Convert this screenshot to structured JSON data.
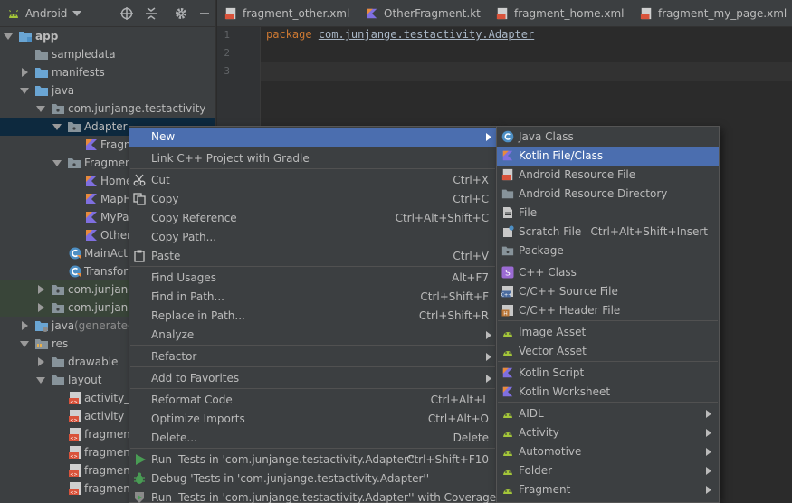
{
  "project_panel": {
    "view_label": "Android",
    "tree": [
      {
        "label": "app",
        "bold": true
      },
      {
        "label": "sampledata"
      },
      {
        "label": "manifests"
      },
      {
        "label": "java"
      },
      {
        "label": "com.junjange.testactivity"
      },
      {
        "label": "Adapter"
      },
      {
        "label": "Fragm"
      },
      {
        "label": "Fragment"
      },
      {
        "label": "Home"
      },
      {
        "label": "MapF"
      },
      {
        "label": "MyPa"
      },
      {
        "label": "Other"
      },
      {
        "label": "MainActi"
      },
      {
        "label": "Transform"
      },
      {
        "label": "com.junjang"
      },
      {
        "label": "com.junjang"
      },
      {
        "label": "java",
        "suffix": "(generated)"
      },
      {
        "label": "res"
      },
      {
        "label": "drawable"
      },
      {
        "label": "layout"
      },
      {
        "label": "activity_n"
      },
      {
        "label": "activity_tr"
      },
      {
        "label": "fragment"
      },
      {
        "label": "fragment"
      },
      {
        "label": "fragment"
      },
      {
        "label": "fragment"
      }
    ]
  },
  "editor": {
    "tabs": [
      {
        "label": "fragment_other.xml",
        "icon": "xml-file-icon"
      },
      {
        "label": "OtherFragment.kt",
        "icon": "kotlin-file-icon"
      },
      {
        "label": "fragment_home.xml",
        "icon": "xml-file-icon"
      },
      {
        "label": "fragment_my_page.xml",
        "icon": "xml-file-icon"
      }
    ],
    "line_numbers": [
      "1",
      "2",
      "3"
    ],
    "keyword": "package",
    "package_name": "com.junjange.testactivity.Adapter"
  },
  "context_menu": [
    {
      "label": "New",
      "submenu": true
    },
    {
      "label": "Link C++ Project with Gradle"
    },
    {
      "label": "Cut",
      "shortcut": "Ctrl+X",
      "icon": "cut"
    },
    {
      "label": "Copy",
      "shortcut": "Ctrl+C",
      "icon": "copy"
    },
    {
      "label": "Copy Reference",
      "shortcut": "Ctrl+Alt+Shift+C"
    },
    {
      "label": "Copy Path..."
    },
    {
      "label": "Paste",
      "shortcut": "Ctrl+V",
      "icon": "paste"
    },
    {
      "label": "Find Usages",
      "shortcut": "Alt+F7"
    },
    {
      "label": "Find in Path...",
      "shortcut": "Ctrl+Shift+F"
    },
    {
      "label": "Replace in Path...",
      "shortcut": "Ctrl+Shift+R"
    },
    {
      "label": "Analyze",
      "submenu": true
    },
    {
      "label": "Refactor",
      "submenu": true
    },
    {
      "label": "Add to Favorites",
      "submenu": true
    },
    {
      "label": "Reformat Code",
      "shortcut": "Ctrl+Alt+L"
    },
    {
      "label": "Optimize Imports",
      "shortcut": "Ctrl+Alt+O"
    },
    {
      "label": "Delete...",
      "shortcut": "Delete"
    },
    {
      "label": "Run 'Tests in 'com.junjange.testactivity.Adapter''",
      "shortcut": "Ctrl+Shift+F10",
      "icon": "run"
    },
    {
      "label": "Debug 'Tests in 'com.junjange.testactivity.Adapter''",
      "icon": "debug"
    },
    {
      "label": "Run 'Tests in 'com.junjange.testactivity.Adapter'' with Coverage",
      "icon": "coverage"
    }
  ],
  "submenu": [
    {
      "label": "Java Class",
      "icon": "java-class"
    },
    {
      "label": "Kotlin File/Class",
      "icon": "kotlin"
    },
    {
      "label": "Android Resource File",
      "icon": "xml"
    },
    {
      "label": "Android Resource Directory",
      "icon": "folder"
    },
    {
      "label": "File",
      "icon": "file"
    },
    {
      "label": "Scratch File",
      "shortcut": "Ctrl+Alt+Shift+Insert",
      "icon": "scratch"
    },
    {
      "label": "Package",
      "icon": "folder"
    },
    {
      "label": "C++ Class",
      "icon": "cpp-class"
    },
    {
      "label": "C/C++ Source File",
      "icon": "cpp-source"
    },
    {
      "label": "C/C++ Header File",
      "icon": "cpp-header"
    },
    {
      "label": "Image Asset",
      "icon": "android"
    },
    {
      "label": "Vector Asset",
      "icon": "android"
    },
    {
      "label": "Kotlin Script",
      "icon": "kotlin"
    },
    {
      "label": "Kotlin Worksheet",
      "icon": "kotlin"
    },
    {
      "label": "AIDL",
      "icon": "android",
      "submenu": true
    },
    {
      "label": "Activity",
      "icon": "android",
      "submenu": true
    },
    {
      "label": "Automotive",
      "icon": "android",
      "submenu": true
    },
    {
      "label": "Folder",
      "icon": "android",
      "submenu": true
    },
    {
      "label": "Fragment",
      "icon": "android",
      "submenu": true
    }
  ],
  "colors": {
    "selection": "#4b6eaf",
    "panel": "#3c3f41",
    "editor": "#2b2b2b",
    "keyword": "#cc7832"
  }
}
